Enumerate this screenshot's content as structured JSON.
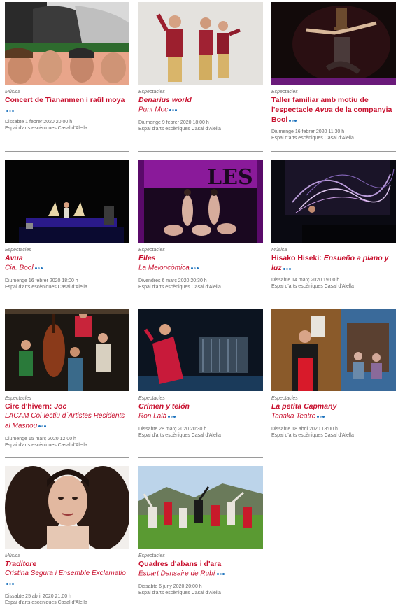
{
  "events": [
    {
      "category": "Música",
      "title": "Concert de Tiananmen i raül moya",
      "company": "",
      "date": "Dissabte 1 febrer 2020 20:00 h",
      "venue": "Espai d'arts escèniques Casal d'Alella"
    },
    {
      "category": "Espectacles",
      "title": "Denarius world",
      "company": "Punt Moc",
      "date": "Diumenge 9 febrer 2020 18:00 h",
      "venue": "Espai d'arts escèniques Casal d'Alella"
    },
    {
      "category": "Espectacles",
      "title_pre": "Taller familiar amb motiu de l'espectacle ",
      "title_em": "Avua",
      "title_post": " de la companyia Bool",
      "company": "",
      "date": "Diumenge 16 febrer 2020 11:30 h",
      "venue": "Espai d'arts escèniques Casal d'Alella"
    },
    {
      "category": "Espectacles",
      "title": "Avua",
      "company": "Cia. Bool",
      "date": "Diumenge 16 febrer 2020 18:00 h",
      "venue": "Espai d'arts escèniques Casal d'Alella"
    },
    {
      "category": "Espectacles",
      "title": "Elles",
      "company": "La Meloncòmica",
      "date": "Divendres 6 març 2020 20:30 h",
      "venue": "Espai d'arts escèniques Casal d'Alella"
    },
    {
      "category": "Música",
      "title_pre": "Hisako Hiseki: ",
      "title_em": "Ensueño a piano y luz",
      "title_post": "",
      "company": "",
      "date": "Dissabte 14 març 2020 19:00 h",
      "venue": "Espai d'arts escèniques Casal d'Alella"
    },
    {
      "category": "Espectacles",
      "title_pre": "Circ d'hivern: ",
      "title_em": "Joc",
      "title_post": "",
      "company": "LACAM Col·lectiu d´Artistes Residents al Masnou",
      "date": "Diumenge 15 març 2020 12:00 h",
      "venue": "Espai d'arts escèniques Casal d'Alella"
    },
    {
      "category": "Espectacles",
      "title": "Crimen y telón",
      "company": "Ron Lalá",
      "date": "Dissabte 28 març 2020 20:30 h",
      "venue": "Espai d'arts escèniques Casal d'Alella"
    },
    {
      "category": "Espectacles",
      "title": "La petita Capmany",
      "company": "Tanaka Teatre",
      "date": "Dissabte 18 abril 2020 18:00 h",
      "venue": "Espai d'arts escèniques Casal d'Alella"
    },
    {
      "category": "Música",
      "title": "Traditore",
      "company": "Cristina Segura i Ensemble Exclamatio",
      "date": "Dissabte 25 abril 2020 21:00 h",
      "venue": "Espai d'arts escèniques Casal d'Alella"
    },
    {
      "category": "Espectacles",
      "title": "Quadres d'abans i d'ara",
      "company": "Esbart Dansaire de Rubí",
      "date": "Dissabte 6 juny 2020 20:00 h",
      "venue": "Espai d'arts escèniques Casal d'Alella"
    }
  ],
  "poster_text": {
    "elles": "LES"
  },
  "colors": {
    "accent": "#c8102e",
    "meta": "#6a6a6a",
    "separator": "#9a9a9a",
    "lang_icon": "#1e73be"
  },
  "icons": {
    "language": "language-flags-icon"
  }
}
